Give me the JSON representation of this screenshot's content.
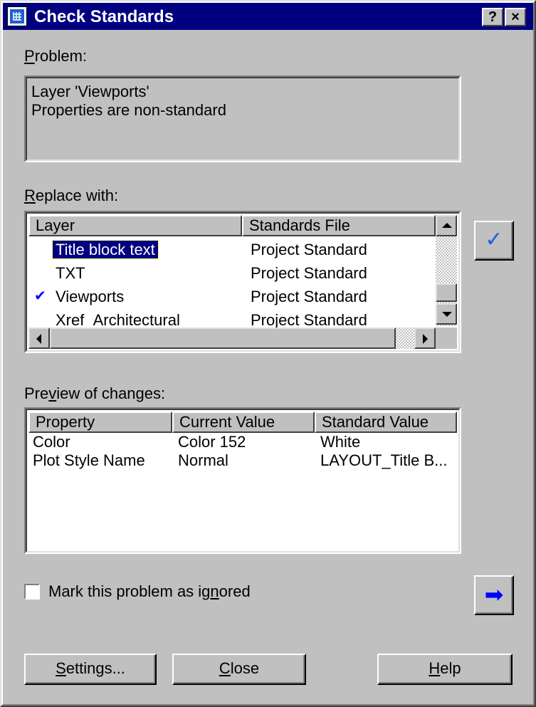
{
  "window": {
    "title": "Check Standards",
    "help_btn": "?",
    "close_btn": "×"
  },
  "problem": {
    "label": "Problem:",
    "line1": "Layer 'Viewports'",
    "line2": "Properties are non-standard"
  },
  "replace": {
    "label": "Replace with:",
    "columns": [
      "Layer",
      "Standards File"
    ],
    "rows": [
      {
        "layer": "Title block text",
        "file": "Project Standard",
        "selected": true,
        "checked": false
      },
      {
        "layer": "TXT",
        "file": "Project Standard",
        "selected": false,
        "checked": false
      },
      {
        "layer": "Viewports",
        "file": "Project Standard",
        "selected": false,
        "checked": true
      },
      {
        "layer": "Xref_Architectural",
        "file": "Project Standard",
        "selected": false,
        "checked": false
      }
    ],
    "check_mark": "✔",
    "fix_button": "✓"
  },
  "preview": {
    "label": "Preview of changes:",
    "columns": [
      "Property",
      "Current Value",
      "Standard Value"
    ],
    "rows": [
      {
        "property": "Color",
        "current": "Color 152",
        "standard": "White"
      },
      {
        "property": "Plot Style Name",
        "current": "Normal",
        "standard": "LAYOUT_Title B..."
      }
    ]
  },
  "ignore": {
    "label": "Mark this problem as ignored",
    "checked": false
  },
  "next_button": "➡",
  "buttons": {
    "settings": "Settings...",
    "close": "Close",
    "help": "Help"
  },
  "colors": {
    "titlebar": "#000080",
    "face": "#c0c0c0",
    "selection": "#000080",
    "check": "#0000ff"
  }
}
